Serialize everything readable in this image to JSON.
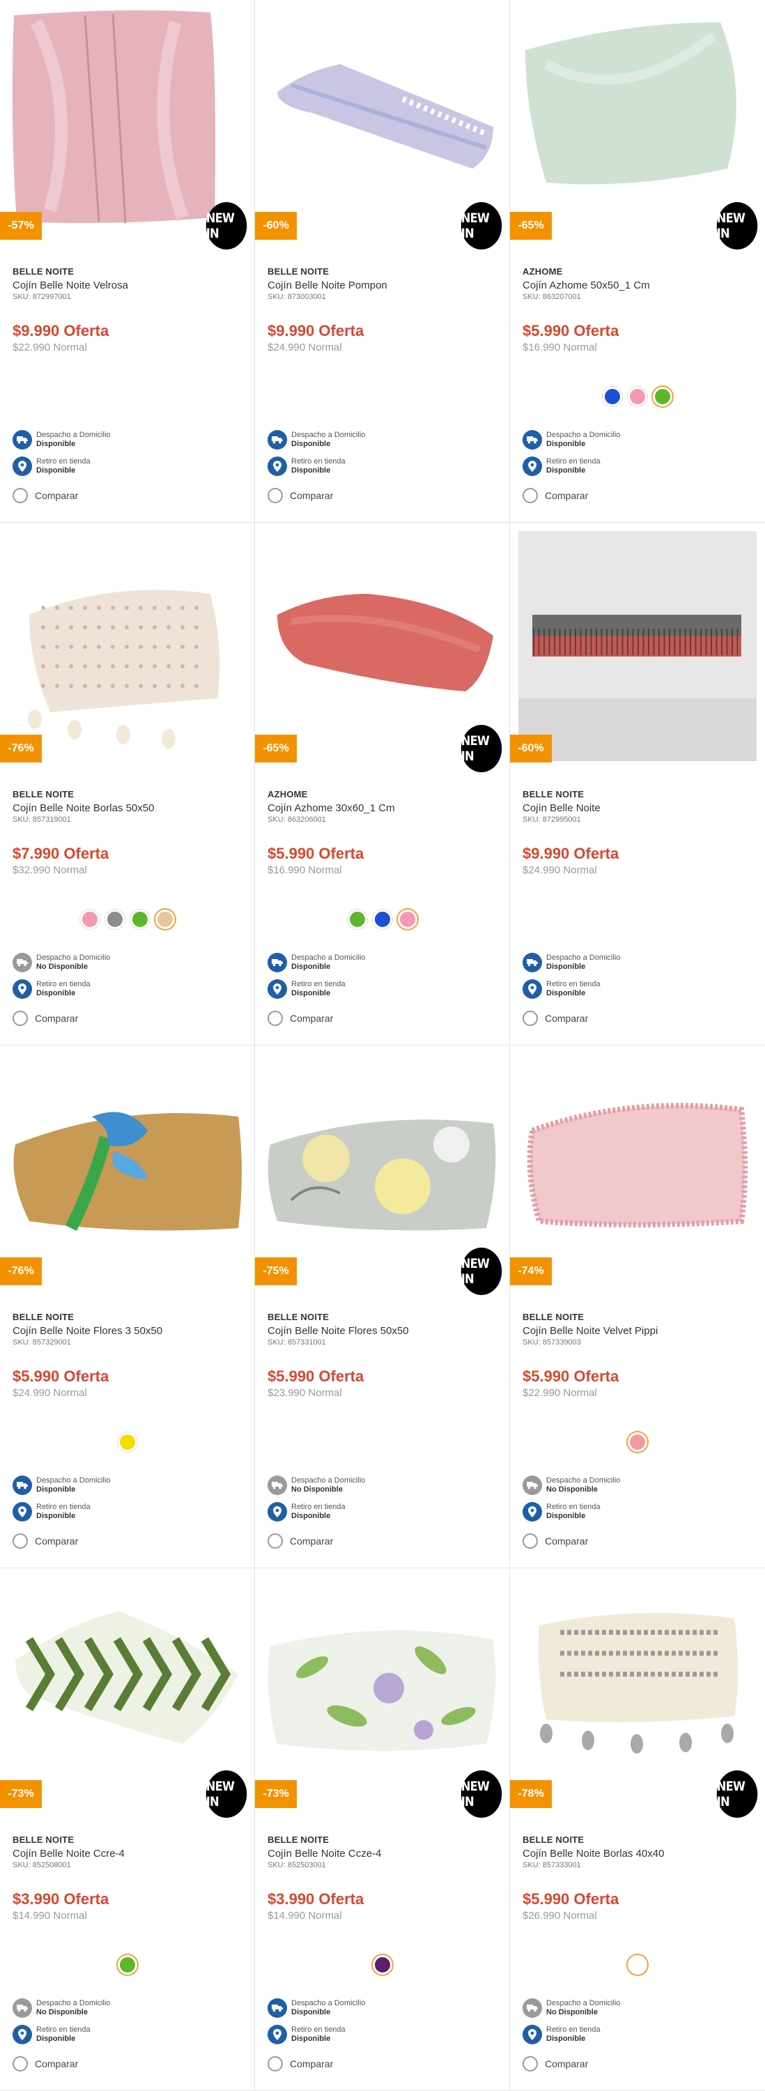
{
  "labels": {
    "delivery": "Despacho a Domicilio",
    "pickup": "Retiro en tienda",
    "compare": "Comparar",
    "new_in": "NEW IN"
  },
  "colors": {
    "accent_price": "#d6482f",
    "discount_badge": "#f39200",
    "availability_icon": "#1e5fa8",
    "availability_icon_off": "#9a9a9a"
  },
  "products": [
    {
      "brand": "BELLE NOITE",
      "name": "Cojín Belle Noite Velrosa",
      "sku": "SKU: 872997001",
      "price": "$9.990 Oferta",
      "normal": "$22.990 Normal",
      "discount": "-57%",
      "new_in": true,
      "swatches": [],
      "delivery_status": "Disponible",
      "delivery_available": true,
      "pickup_status": "Disponible",
      "image": "square-velvet-pink"
    },
    {
      "brand": "BELLE NOITE",
      "name": "Cojín Belle Noite Pompon",
      "sku": "SKU: 873003001",
      "price": "$9.990 Oferta",
      "normal": "$24.990 Normal",
      "discount": "-60%",
      "new_in": true,
      "swatches": [],
      "delivery_status": "Disponible",
      "delivery_available": true,
      "pickup_status": "Disponible",
      "image": "long-lilac-pompon"
    },
    {
      "brand": "AZHOME",
      "name": "Cojín Azhome 50x50_1 Cm",
      "sku": "SKU: 863207001",
      "price": "$5.990 Oferta",
      "normal": "$16.990 Normal",
      "discount": "-65%",
      "new_in": true,
      "swatches": [
        {
          "color": "#1a4fd8",
          "selected": false
        },
        {
          "color": "#f59ab0",
          "selected": false
        },
        {
          "color": "#5cb82a",
          "selected": true
        }
      ],
      "delivery_status": "Disponible",
      "delivery_available": true,
      "pickup_status": "Disponible",
      "image": "square-mint"
    },
    {
      "brand": "BELLE NOITE",
      "name": "Cojín Belle Noite Borlas 50x50",
      "sku": "SKU: 857319001",
      "price": "$7.990 Oferta",
      "normal": "$32.990 Normal",
      "discount": "-76%",
      "new_in": false,
      "swatches": [
        {
          "color": "#f599b0",
          "selected": false
        },
        {
          "color": "#8c8c8c",
          "selected": false
        },
        {
          "color": "#5cb82a",
          "selected": false
        },
        {
          "color": "#e6c79a",
          "selected": true
        }
      ],
      "delivery_status": "No Disponible",
      "delivery_available": false,
      "pickup_status": "Disponible",
      "image": "square-tassel-beige"
    },
    {
      "brand": "AZHOME",
      "name": "Cojín Azhome 30x60_1 Cm",
      "sku": "SKU: 863206001",
      "price": "$5.990 Oferta",
      "normal": "$16.990 Normal",
      "discount": "-65%",
      "new_in": true,
      "swatches": [
        {
          "color": "#5cb82a",
          "selected": false
        },
        {
          "color": "#1a4fd8",
          "selected": false
        },
        {
          "color": "#f59ab0",
          "selected": true
        }
      ],
      "delivery_status": "Disponible",
      "delivery_available": true,
      "pickup_status": "Disponible",
      "image": "rect-coral"
    },
    {
      "brand": "BELLE NOITE",
      "name": "Cojín Belle Noite",
      "sku": "SKU: 872995001",
      "price": "$9.990 Oferta",
      "normal": "$24.990 Normal",
      "discount": "-60%",
      "new_in": false,
      "swatches": [],
      "delivery_status": "Disponible",
      "delivery_available": true,
      "pickup_status": "Disponible",
      "image": "long-dark-fringe"
    },
    {
      "brand": "BELLE NOITE",
      "name": "Cojín Belle Noite Flores 3 50x50",
      "sku": "SKU: 857329001",
      "price": "$5.990 Oferta",
      "normal": "$24.990 Normal",
      "discount": "-76%",
      "new_in": false,
      "swatches": [
        {
          "color": "#f5dd00",
          "selected": false
        }
      ],
      "delivery_status": "Disponible",
      "delivery_available": true,
      "pickup_status": "Disponible",
      "image": "square-mustard-flower"
    },
    {
      "brand": "BELLE NOITE",
      "name": "Cojín Belle Noite Flores 50x50",
      "sku": "SKU: 857331001",
      "price": "$5.990 Oferta",
      "normal": "$23.990 Normal",
      "discount": "-75%",
      "new_in": true,
      "swatches": [],
      "delivery_status": "No Disponible",
      "delivery_available": false,
      "pickup_status": "Disponible",
      "image": "square-floral-grey"
    },
    {
      "brand": "BELLE NOITE",
      "name": "Cojín Belle Noite Velvet Pippi",
      "sku": "SKU: 857339003",
      "price": "$5.990 Oferta",
      "normal": "$22.990 Normal",
      "discount": "-74%",
      "new_in": false,
      "swatches": [
        {
          "color": "#f39aa4",
          "selected": true
        }
      ],
      "delivery_status": "No Disponible",
      "delivery_available": false,
      "pickup_status": "Disponible",
      "image": "square-pink-ruffle"
    },
    {
      "brand": "BELLE NOITE",
      "name": "Cojín Belle Noite Ccre-4",
      "sku": "SKU: 852508001",
      "price": "$3.990 Oferta",
      "normal": "$14.990 Normal",
      "discount": "-73%",
      "new_in": true,
      "swatches": [
        {
          "color": "#5cb82a",
          "selected": true
        }
      ],
      "delivery_status": "No Disponible",
      "delivery_available": false,
      "pickup_status": "Disponible",
      "image": "rect-green-chevron"
    },
    {
      "brand": "BELLE NOITE",
      "name": "Cojín Belle Noite Ccze-4",
      "sku": "SKU: 852503001",
      "price": "$3.990 Oferta",
      "normal": "$14.990 Normal",
      "discount": "-73%",
      "new_in": true,
      "swatches": [
        {
          "color": "#5a1f6e",
          "selected": true
        }
      ],
      "delivery_status": "Disponible",
      "delivery_available": true,
      "pickup_status": "Disponible",
      "image": "square-botanical"
    },
    {
      "brand": "BELLE NOITE",
      "name": "Cojín Belle Noite Borlas 40x40",
      "sku": "SKU: 857333001",
      "price": "$5.990 Oferta",
      "normal": "$26.990 Normal",
      "discount": "-78%",
      "new_in": true,
      "swatches": [
        {
          "color": "#ffffff",
          "selected": true
        }
      ],
      "delivery_status": "No Disponible",
      "delivery_available": false,
      "pickup_status": "Disponible",
      "image": "square-tassel-cream"
    }
  ]
}
